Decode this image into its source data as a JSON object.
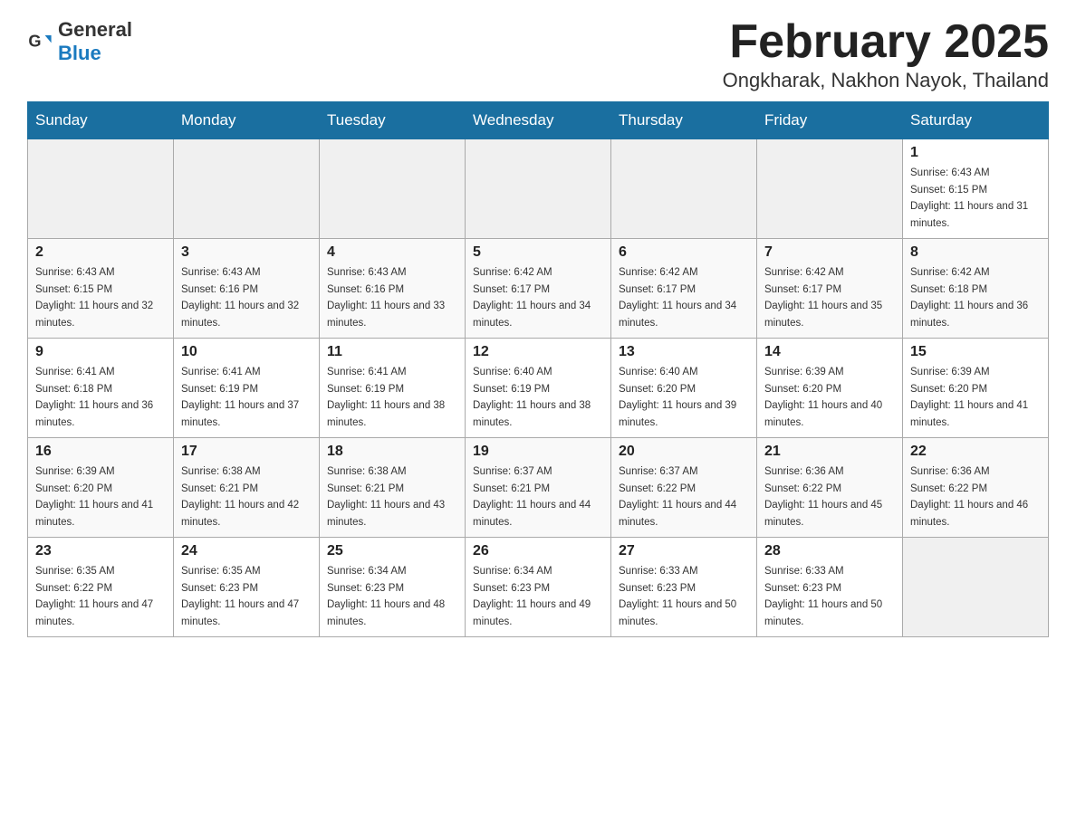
{
  "header": {
    "logo_general": "General",
    "logo_blue": "Blue",
    "month_title": "February 2025",
    "location": "Ongkharak, Nakhon Nayok, Thailand"
  },
  "weekdays": [
    "Sunday",
    "Monday",
    "Tuesday",
    "Wednesday",
    "Thursday",
    "Friday",
    "Saturday"
  ],
  "weeks": [
    [
      {
        "day": "",
        "sunrise": "",
        "sunset": "",
        "daylight": ""
      },
      {
        "day": "",
        "sunrise": "",
        "sunset": "",
        "daylight": ""
      },
      {
        "day": "",
        "sunrise": "",
        "sunset": "",
        "daylight": ""
      },
      {
        "day": "",
        "sunrise": "",
        "sunset": "",
        "daylight": ""
      },
      {
        "day": "",
        "sunrise": "",
        "sunset": "",
        "daylight": ""
      },
      {
        "day": "",
        "sunrise": "",
        "sunset": "",
        "daylight": ""
      },
      {
        "day": "1",
        "sunrise": "Sunrise: 6:43 AM",
        "sunset": "Sunset: 6:15 PM",
        "daylight": "Daylight: 11 hours and 31 minutes."
      }
    ],
    [
      {
        "day": "2",
        "sunrise": "Sunrise: 6:43 AM",
        "sunset": "Sunset: 6:15 PM",
        "daylight": "Daylight: 11 hours and 32 minutes."
      },
      {
        "day": "3",
        "sunrise": "Sunrise: 6:43 AM",
        "sunset": "Sunset: 6:16 PM",
        "daylight": "Daylight: 11 hours and 32 minutes."
      },
      {
        "day": "4",
        "sunrise": "Sunrise: 6:43 AM",
        "sunset": "Sunset: 6:16 PM",
        "daylight": "Daylight: 11 hours and 33 minutes."
      },
      {
        "day": "5",
        "sunrise": "Sunrise: 6:42 AM",
        "sunset": "Sunset: 6:17 PM",
        "daylight": "Daylight: 11 hours and 34 minutes."
      },
      {
        "day": "6",
        "sunrise": "Sunrise: 6:42 AM",
        "sunset": "Sunset: 6:17 PM",
        "daylight": "Daylight: 11 hours and 34 minutes."
      },
      {
        "day": "7",
        "sunrise": "Sunrise: 6:42 AM",
        "sunset": "Sunset: 6:17 PM",
        "daylight": "Daylight: 11 hours and 35 minutes."
      },
      {
        "day": "8",
        "sunrise": "Sunrise: 6:42 AM",
        "sunset": "Sunset: 6:18 PM",
        "daylight": "Daylight: 11 hours and 36 minutes."
      }
    ],
    [
      {
        "day": "9",
        "sunrise": "Sunrise: 6:41 AM",
        "sunset": "Sunset: 6:18 PM",
        "daylight": "Daylight: 11 hours and 36 minutes."
      },
      {
        "day": "10",
        "sunrise": "Sunrise: 6:41 AM",
        "sunset": "Sunset: 6:19 PM",
        "daylight": "Daylight: 11 hours and 37 minutes."
      },
      {
        "day": "11",
        "sunrise": "Sunrise: 6:41 AM",
        "sunset": "Sunset: 6:19 PM",
        "daylight": "Daylight: 11 hours and 38 minutes."
      },
      {
        "day": "12",
        "sunrise": "Sunrise: 6:40 AM",
        "sunset": "Sunset: 6:19 PM",
        "daylight": "Daylight: 11 hours and 38 minutes."
      },
      {
        "day": "13",
        "sunrise": "Sunrise: 6:40 AM",
        "sunset": "Sunset: 6:20 PM",
        "daylight": "Daylight: 11 hours and 39 minutes."
      },
      {
        "day": "14",
        "sunrise": "Sunrise: 6:39 AM",
        "sunset": "Sunset: 6:20 PM",
        "daylight": "Daylight: 11 hours and 40 minutes."
      },
      {
        "day": "15",
        "sunrise": "Sunrise: 6:39 AM",
        "sunset": "Sunset: 6:20 PM",
        "daylight": "Daylight: 11 hours and 41 minutes."
      }
    ],
    [
      {
        "day": "16",
        "sunrise": "Sunrise: 6:39 AM",
        "sunset": "Sunset: 6:20 PM",
        "daylight": "Daylight: 11 hours and 41 minutes."
      },
      {
        "day": "17",
        "sunrise": "Sunrise: 6:38 AM",
        "sunset": "Sunset: 6:21 PM",
        "daylight": "Daylight: 11 hours and 42 minutes."
      },
      {
        "day": "18",
        "sunrise": "Sunrise: 6:38 AM",
        "sunset": "Sunset: 6:21 PM",
        "daylight": "Daylight: 11 hours and 43 minutes."
      },
      {
        "day": "19",
        "sunrise": "Sunrise: 6:37 AM",
        "sunset": "Sunset: 6:21 PM",
        "daylight": "Daylight: 11 hours and 44 minutes."
      },
      {
        "day": "20",
        "sunrise": "Sunrise: 6:37 AM",
        "sunset": "Sunset: 6:22 PM",
        "daylight": "Daylight: 11 hours and 44 minutes."
      },
      {
        "day": "21",
        "sunrise": "Sunrise: 6:36 AM",
        "sunset": "Sunset: 6:22 PM",
        "daylight": "Daylight: 11 hours and 45 minutes."
      },
      {
        "day": "22",
        "sunrise": "Sunrise: 6:36 AM",
        "sunset": "Sunset: 6:22 PM",
        "daylight": "Daylight: 11 hours and 46 minutes."
      }
    ],
    [
      {
        "day": "23",
        "sunrise": "Sunrise: 6:35 AM",
        "sunset": "Sunset: 6:22 PM",
        "daylight": "Daylight: 11 hours and 47 minutes."
      },
      {
        "day": "24",
        "sunrise": "Sunrise: 6:35 AM",
        "sunset": "Sunset: 6:23 PM",
        "daylight": "Daylight: 11 hours and 47 minutes."
      },
      {
        "day": "25",
        "sunrise": "Sunrise: 6:34 AM",
        "sunset": "Sunset: 6:23 PM",
        "daylight": "Daylight: 11 hours and 48 minutes."
      },
      {
        "day": "26",
        "sunrise": "Sunrise: 6:34 AM",
        "sunset": "Sunset: 6:23 PM",
        "daylight": "Daylight: 11 hours and 49 minutes."
      },
      {
        "day": "27",
        "sunrise": "Sunrise: 6:33 AM",
        "sunset": "Sunset: 6:23 PM",
        "daylight": "Daylight: 11 hours and 50 minutes."
      },
      {
        "day": "28",
        "sunrise": "Sunrise: 6:33 AM",
        "sunset": "Sunset: 6:23 PM",
        "daylight": "Daylight: 11 hours and 50 minutes."
      },
      {
        "day": "",
        "sunrise": "",
        "sunset": "",
        "daylight": ""
      }
    ]
  ]
}
